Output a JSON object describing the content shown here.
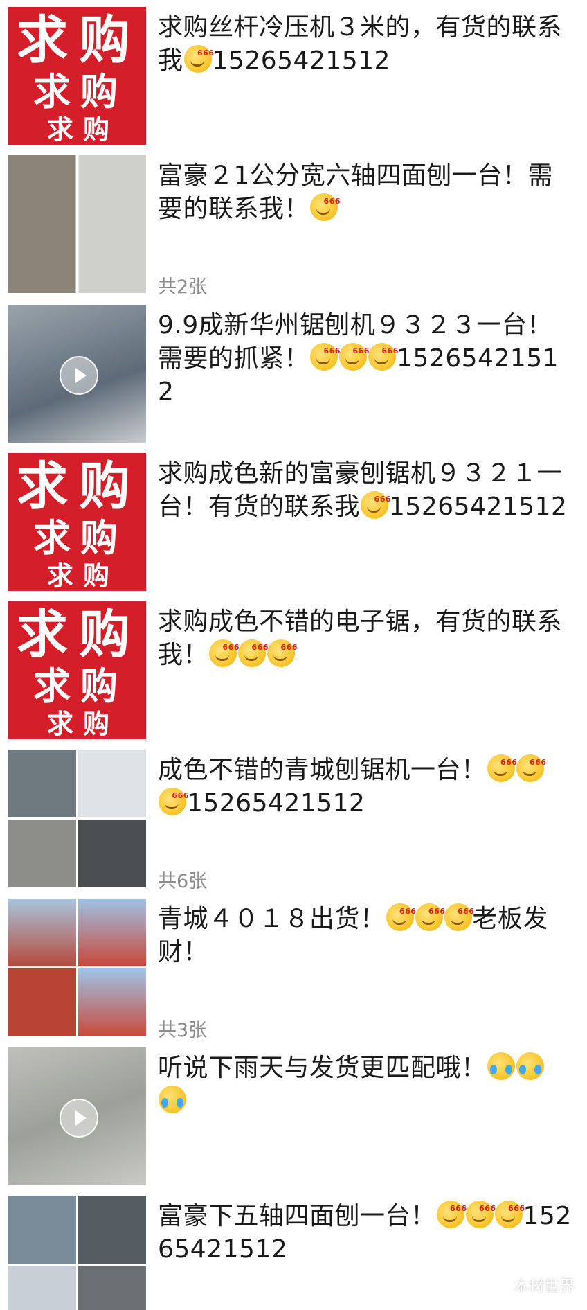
{
  "posts": [
    {
      "text_before": "求购丝杆冷压机３米的，有货的联系我",
      "text_after": "15265421512",
      "emojis": 1,
      "thumb": "qiugou"
    },
    {
      "text_before": "富豪２1公分宽六轴四面刨一台！需要的联系我！",
      "text_after": "",
      "emojis": 1,
      "thumb": "photo",
      "count": "共2张"
    },
    {
      "text_before": "9.9成新华州锯刨机９３２３一台！需要的抓紧！",
      "text_after": "15265421512",
      "emojis": 3,
      "thumb": "video"
    },
    {
      "text_before": "求购成色新的富豪刨锯机９３２１一台！有货的联系我",
      "text_after": "15265421512",
      "emojis": 1,
      "thumb": "qiugou"
    },
    {
      "text_before": "求购成色不错的电子锯，有货的联系我！",
      "text_after": "",
      "emojis": 3,
      "thumb": "qiugou"
    },
    {
      "text_before": "成色不错的青城刨锯机一台！",
      "text_after": "15265421512",
      "emojis": 3,
      "thumb": "photo",
      "count": "共6张"
    },
    {
      "text_before": "青城４０１８出货！",
      "text_after": "老板发财！",
      "emojis": 3,
      "thumb": "photo",
      "count": "共3张"
    },
    {
      "text_before": "听说下雨天与发货更匹配哦！",
      "text_after": "",
      "emojis": 3,
      "emoji_type": "cry",
      "thumb": "video"
    },
    {
      "text_before": "富豪下五轴四面刨一台！",
      "text_after": "15265421512",
      "emojis": 3,
      "thumb": "photo"
    }
  ],
  "qiugou": {
    "big": "求购",
    "mid": "求购",
    "small": "求购"
  },
  "watermark": "木材世界",
  "colors": {
    "tile_red": "#d41f2a",
    "count_gray": "#8c8c8c"
  }
}
